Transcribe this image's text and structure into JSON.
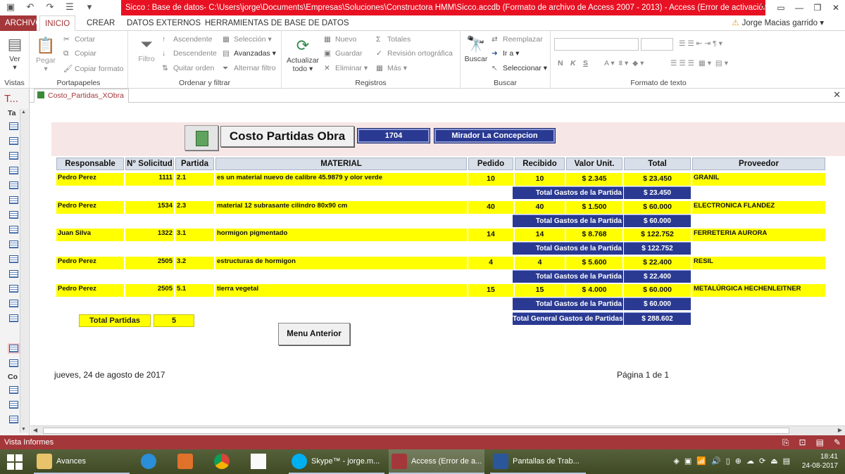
{
  "window": {
    "title": "Sicco : Base de datos- C:\\Users\\jorge\\Documents\\Empresas\\Soluciones\\Constructora HMM\\Sicco.accdb (Formato de archivo de Access 2007 - 2013) -  Access (Error de activación de productos)",
    "help": "?",
    "restore_ribbon": "▭",
    "minimize": "—",
    "maximize": "❐",
    "close": "✕"
  },
  "ribbon_tabs": [
    "ARCHIVO",
    "INICIO",
    "CREAR",
    "DATOS EXTERNOS",
    "HERRAMIENTAS DE BASE DE DATOS"
  ],
  "user_name": "Jorge Macias garrido",
  "ribbon": {
    "vistas": {
      "label": "Vistas",
      "ver": "Ver"
    },
    "portapapeles": {
      "label": "Portapapeles",
      "pegar": "Pegar",
      "cortar": "Cortar",
      "copiar": "Copiar",
      "copiar_formato": "Copiar formato"
    },
    "ordenar": {
      "label": "Ordenar y filtrar",
      "filtro": "Filtro",
      "ascendente": "Ascendente",
      "descendente": "Descendente",
      "quitar_orden": "Quitar orden",
      "seleccion": "Selección",
      "avanzadas": "Avanzadas",
      "alternar_filtro": "Alternar filtro"
    },
    "registros": {
      "label": "Registros",
      "actualizar": "Actualizar",
      "todo": "todo",
      "nuevo": "Nuevo",
      "guardar": "Guardar",
      "eliminar": "Eliminar",
      "totales": "Totales",
      "revision": "Revisión ortográfica",
      "mas": "Más"
    },
    "buscar": {
      "label": "Buscar",
      "buscar": "Buscar",
      "reemplazar": "Reemplazar",
      "ir_a": "Ir a",
      "seleccionar": "Seleccionar"
    },
    "formato": {
      "label": "Formato de texto",
      "bold": "N",
      "italic": "K",
      "underline": "S"
    }
  },
  "object_tab": "Costo_Partidas_XObra",
  "nav": {
    "title": "T...",
    "section1": "Ta",
    "section2": "Co"
  },
  "report": {
    "title": "Costo Partidas Obra",
    "obra_id": "1704",
    "obra_name": "Mirador La Concepcion",
    "columns": [
      "Responsable",
      "N° Solicitud",
      "Partida",
      "MATERIAL",
      "Pedido",
      "Recibido",
      "Valor Unit.",
      "Total",
      "Proveedor"
    ],
    "rows": [
      {
        "responsable": "Pedro Perez",
        "solicitud": "1111",
        "partida": "2.1",
        "material": "es un material nuevo de calibre 45.9879 y olor verde",
        "pedido": "10",
        "recibido": "10",
        "valor": "$ 2.345",
        "total": "$ 23.450",
        "proveedor": "GRANIL",
        "subtotal_label": "Total Gastos de la Partida",
        "subtotal": "$ 23.450"
      },
      {
        "responsable": "Pedro Perez",
        "solicitud": "1534",
        "partida": "2.3",
        "material": "material 12 subrasante cilindro 80x90 cm",
        "pedido": "40",
        "recibido": "40",
        "valor": "$ 1.500",
        "total": "$ 60.000",
        "proveedor": "ELECTRONICA FLANDEZ",
        "subtotal_label": "Total Gastos de la Partida",
        "subtotal": "$ 60.000"
      },
      {
        "responsable": "Juan Silva",
        "solicitud": "1322",
        "partida": "3.1",
        "material": "hormigon pigmentado",
        "pedido": "14",
        "recibido": "14",
        "valor": "$ 8.768",
        "total": "$ 122.752",
        "proveedor": "FERRETERIA AURORA",
        "subtotal_label": "Total Gastos de la Partida",
        "subtotal": "$ 122.752"
      },
      {
        "responsable": "Pedro Perez",
        "solicitud": "2505",
        "partida": "3.2",
        "material": "estructuras de hormigon",
        "pedido": "4",
        "recibido": "4",
        "valor": "$ 5.600",
        "total": "$ 22.400",
        "proveedor": "RESIL",
        "subtotal_label": "Total Gastos de la Partida",
        "subtotal": "$ 22.400"
      },
      {
        "responsable": "Pedro Perez",
        "solicitud": "2505",
        "partida": "5.1",
        "material": "tierra vegetal",
        "pedido": "15",
        "recibido": "15",
        "valor": "$ 4.000",
        "total": "$ 60.000",
        "proveedor": "METALÚRGICA HECHENLEITNER",
        "subtotal_label": "Total Gastos de la Partida",
        "subtotal": "$ 60.000"
      }
    ],
    "grand_total_label": "Total General Gastos de Partidas",
    "grand_total": "$ 288.602",
    "total_partidas_label": "Total  Partidas",
    "total_partidas": "5",
    "menu_button": "Menu Anterior",
    "footer_date": "jueves, 24 de agosto de 2017",
    "footer_page": "Página 1 de 1"
  },
  "status_bar": {
    "text": "Vista Informes"
  },
  "taskbar": {
    "tasks": [
      "Avances",
      "Skype™ - jorge.m...",
      "Access (Error de a...",
      "Pantallas de Trab..."
    ],
    "time": "18:41",
    "date": "24-08-2017"
  },
  "colors": {
    "access_red": "#a4373a",
    "title_red": "#e81123",
    "report_yellow": "#ffff00",
    "report_navy": "#2a3a92",
    "header_gray": "#d9dfe8"
  }
}
